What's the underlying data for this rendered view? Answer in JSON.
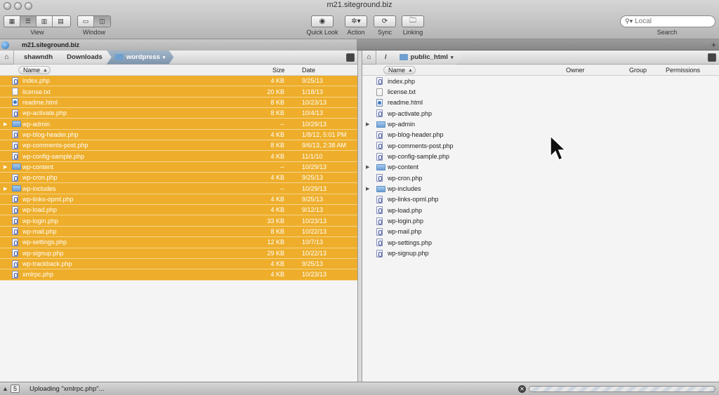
{
  "window": {
    "title": "m21.siteground.biz"
  },
  "toolbar": {
    "view_label": "View",
    "window_label": "Window",
    "quicklook_label": "Quick Look",
    "action_label": "Action",
    "sync_label": "Sync",
    "linking_label": "Linking",
    "search_label": "Search",
    "search_placeholder": "Local"
  },
  "tab": {
    "title": "m21.siteground.biz"
  },
  "left": {
    "breadcrumb": [
      "shawndh",
      "Downloads",
      "wordpress"
    ],
    "columns": {
      "name": "Name",
      "size": "Size",
      "date": "Date"
    },
    "files": [
      {
        "name": "index.php",
        "kind": "php",
        "size": "4 KB",
        "date": "9/25/13",
        "expandable": false
      },
      {
        "name": "license.txt",
        "kind": "txt",
        "size": "20 KB",
        "date": "1/18/13",
        "expandable": false
      },
      {
        "name": "readme.html",
        "kind": "html",
        "size": "8 KB",
        "date": "10/23/13",
        "expandable": false
      },
      {
        "name": "wp-activate.php",
        "kind": "php",
        "size": "8 KB",
        "date": "10/4/13",
        "expandable": false
      },
      {
        "name": "wp-admin",
        "kind": "folder",
        "size": "--",
        "date": "10/29/13",
        "expandable": true
      },
      {
        "name": "wp-blog-header.php",
        "kind": "php",
        "size": "4 KB",
        "date": "1/8/12, 5:01 PM",
        "expandable": false
      },
      {
        "name": "wp-comments-post.php",
        "kind": "php",
        "size": "8 KB",
        "date": "9/6/13, 2:38 AM",
        "expandable": false
      },
      {
        "name": "wp-config-sample.php",
        "kind": "php",
        "size": "4 KB",
        "date": "11/1/10",
        "expandable": false
      },
      {
        "name": "wp-content",
        "kind": "folder",
        "size": "--",
        "date": "10/29/13",
        "expandable": true
      },
      {
        "name": "wp-cron.php",
        "kind": "php",
        "size": "4 KB",
        "date": "9/25/13",
        "expandable": false
      },
      {
        "name": "wp-includes",
        "kind": "folder",
        "size": "--",
        "date": "10/29/13",
        "expandable": true
      },
      {
        "name": "wp-links-opml.php",
        "kind": "php",
        "size": "4 KB",
        "date": "9/25/13",
        "expandable": false
      },
      {
        "name": "wp-load.php",
        "kind": "php",
        "size": "4 KB",
        "date": "9/12/13",
        "expandable": false
      },
      {
        "name": "wp-login.php",
        "kind": "php",
        "size": "33 KB",
        "date": "10/23/13",
        "expandable": false
      },
      {
        "name": "wp-mail.php",
        "kind": "php",
        "size": "8 KB",
        "date": "10/22/13",
        "expandable": false
      },
      {
        "name": "wp-settings.php",
        "kind": "php",
        "size": "12 KB",
        "date": "10/7/13",
        "expandable": false
      },
      {
        "name": "wp-signup.php",
        "kind": "php",
        "size": "29 KB",
        "date": "10/22/13",
        "expandable": false
      },
      {
        "name": "wp-trackback.php",
        "kind": "php",
        "size": "4 KB",
        "date": "9/25/13",
        "expandable": false
      },
      {
        "name": "xmlrpc.php",
        "kind": "php",
        "size": "4 KB",
        "date": "10/23/13",
        "expandable": false
      }
    ]
  },
  "right": {
    "breadcrumb": [
      "/",
      "public_html"
    ],
    "columns": {
      "name": "Name",
      "owner": "Owner",
      "group": "Group",
      "permissions": "Permissions"
    },
    "files": [
      {
        "name": "index.php",
        "kind": "php",
        "expandable": false
      },
      {
        "name": "license.txt",
        "kind": "txt",
        "expandable": false
      },
      {
        "name": "readme.html",
        "kind": "html",
        "expandable": false
      },
      {
        "name": "wp-activate.php",
        "kind": "php",
        "expandable": false
      },
      {
        "name": "wp-admin",
        "kind": "folder",
        "expandable": true
      },
      {
        "name": "wp-blog-header.php",
        "kind": "php",
        "expandable": false
      },
      {
        "name": "wp-comments-post.php",
        "kind": "php",
        "expandable": false
      },
      {
        "name": "wp-config-sample.php",
        "kind": "php",
        "expandable": false
      },
      {
        "name": "wp-content",
        "kind": "folder",
        "expandable": true
      },
      {
        "name": "wp-cron.php",
        "kind": "php",
        "expandable": false
      },
      {
        "name": "wp-includes",
        "kind": "folder",
        "expandable": true
      },
      {
        "name": "wp-links-opml.php",
        "kind": "php",
        "expandable": false
      },
      {
        "name": "wp-load.php",
        "kind": "php",
        "expandable": false
      },
      {
        "name": "wp-login.php",
        "kind": "php",
        "expandable": false
      },
      {
        "name": "wp-mail.php",
        "kind": "php",
        "expandable": false
      },
      {
        "name": "wp-settings.php",
        "kind": "php",
        "expandable": false
      },
      {
        "name": "wp-signup.php",
        "kind": "php",
        "expandable": false
      }
    ]
  },
  "status": {
    "queue_count": "5",
    "message": "Uploading \"xmlrpc.php\"...",
    "progress_fraction": 0.0
  },
  "colors": {
    "selection": "#eeae2b",
    "accent": "#6f9fd4"
  },
  "icons": {
    "view_icons": "grid-icon",
    "view_list": "list-icon",
    "view_columns": "columns-icon",
    "view_coverflow": "coverflow-icon",
    "window_single": "single-pane-icon",
    "window_dual": "dual-pane-icon",
    "quicklook": "eye-icon",
    "action": "gear-icon",
    "sync": "sync-icon",
    "linking": "link-folder-icon",
    "search": "magnifier-icon"
  }
}
